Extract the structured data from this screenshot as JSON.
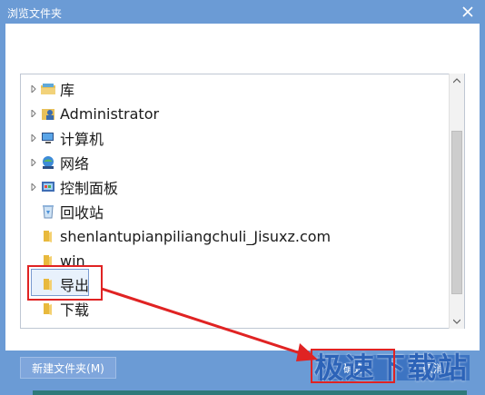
{
  "dialog": {
    "title": "浏览文件夹",
    "close_icon": "close-icon"
  },
  "tree": {
    "items": [
      {
        "label": "库",
        "icon": "library-icon",
        "expandable": true
      },
      {
        "label": "Administrator",
        "icon": "user-folder-icon",
        "expandable": true
      },
      {
        "label": "计算机",
        "icon": "computer-icon",
        "expandable": true
      },
      {
        "label": "网络",
        "icon": "network-icon",
        "expandable": true
      },
      {
        "label": "控制面板",
        "icon": "control-panel-icon",
        "expandable": true
      },
      {
        "label": "回收站",
        "icon": "recycle-bin-icon",
        "expandable": false
      },
      {
        "label": "shenlantupianpiliangchuli_Jisuxz.com",
        "icon": "folder-icon",
        "expandable": false
      },
      {
        "label": "win",
        "icon": "folder-icon",
        "expandable": false
      },
      {
        "label": "导出",
        "icon": "folder-icon",
        "expandable": false,
        "selected": true
      },
      {
        "label": "下载",
        "icon": "folder-icon",
        "expandable": false
      }
    ]
  },
  "buttons": {
    "new_folder": "新建文件夹(M)",
    "ok": "确定",
    "cancel": "取消"
  },
  "watermark": "极速下载站",
  "colors": {
    "frame": "#6b9bd5",
    "button": "#3d74c2",
    "highlight": "#e02323"
  }
}
